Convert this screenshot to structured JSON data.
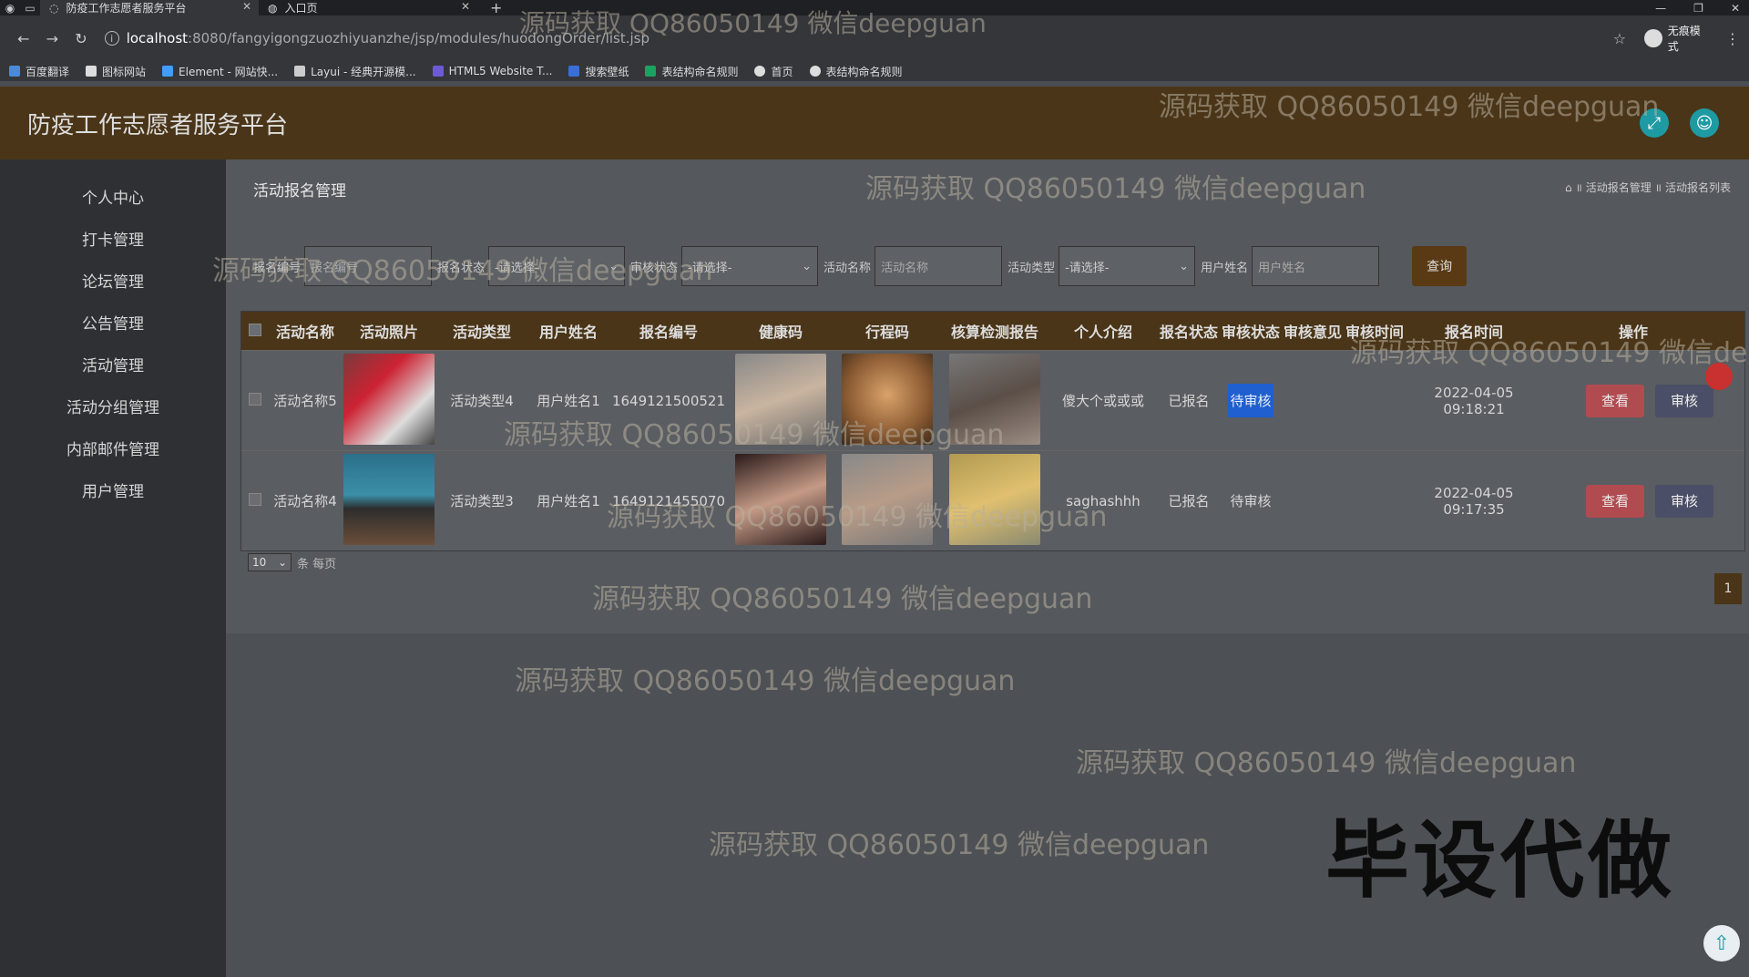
{
  "browser": {
    "tabs": [
      {
        "title": "防疫工作志愿者服务平台",
        "active": true
      },
      {
        "title": "入口页",
        "active": false
      }
    ],
    "url_host": "localhost",
    "url_path": ":8080/fangyigongzuozhiyuanzhe/jsp/modules/huodongOrder/list.jsp",
    "profile_label": "无痕模式",
    "bookmarks": [
      "百度翻译",
      "图标网站",
      "Element - 网站快...",
      "Layui - 经典开源模...",
      "HTML5 Website T...",
      "搜索壁纸",
      "表结构命名规则",
      "首页",
      "表结构命名规则"
    ]
  },
  "app": {
    "title": "防疫工作志愿者服务平台",
    "sidebar": [
      "个人中心",
      "打卡管理",
      "论坛管理",
      "公告管理",
      "活动管理",
      "活动分组管理",
      "内部邮件管理",
      "用户管理"
    ],
    "page_title": "活动报名管理",
    "breadcrumb": [
      "活动报名管理",
      "活动报名列表"
    ],
    "search": {
      "field1_label": "报名编号",
      "field1_placeholder": "报名编号",
      "field2_label": "报名状态",
      "field2_value": "-请选择-",
      "field3_label": "审核状态",
      "field3_value": "-请选择-",
      "field4_label": "活动名称",
      "field4_placeholder": "活动名称",
      "field5_label": "活动类型",
      "field5_value": "-请选择-",
      "field6_label": "用户姓名",
      "field6_placeholder": "用户姓名",
      "query_label": "查询"
    },
    "table": {
      "headers": [
        "活动名称",
        "活动照片",
        "活动类型",
        "用户姓名",
        "报名编号",
        "健康码",
        "行程码",
        "核算检测报告",
        "个人介绍",
        "报名状态",
        "审核状态",
        "审核意见",
        "审核时间",
        "报名时间",
        "操作"
      ],
      "rows": [
        {
          "name": "活动名称5",
          "type": "活动类型4",
          "user": "用户姓名1",
          "order_no": "1649121500521",
          "intro": "傻大个或或或",
          "signup_status": "已报名",
          "audit_status": "待审核",
          "audit_opinion": "",
          "audit_time": "",
          "signup_time": "2022-04-05 09:18:21",
          "view": "查看",
          "audit": "审核"
        },
        {
          "name": "活动名称4",
          "type": "活动类型3",
          "user": "用户姓名1",
          "order_no": "1649121455070",
          "intro": "saghashhh",
          "signup_status": "已报名",
          "audit_status": "待审核",
          "audit_opinion": "",
          "audit_time": "",
          "signup_time": "2022-04-05 09:17:35",
          "view": "查看",
          "audit": "审核"
        }
      ]
    },
    "pager": {
      "page_size": "10",
      "per_page_label": "条 每页",
      "current_page": "1"
    }
  },
  "overlays": {
    "watermark": "源码获取 QQ86050149 微信deepguan",
    "promo": "毕设代做"
  },
  "colors": {
    "header": "#4a3518",
    "sidebar": "#2e3033",
    "accent": "#1e9aa3",
    "pending": "#1f5fd0",
    "view_btn": "#b04b4f"
  }
}
